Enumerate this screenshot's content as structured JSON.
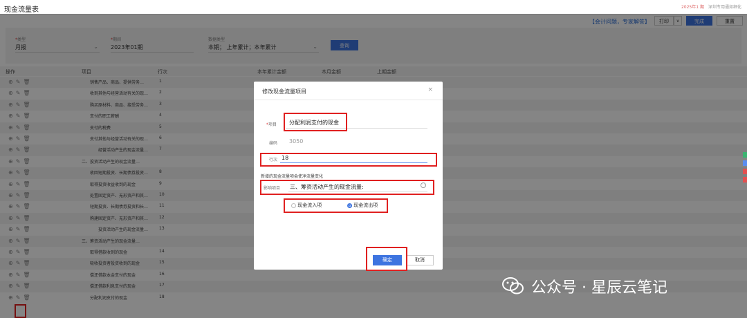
{
  "header": {
    "title": "现金流量表",
    "info_1": "2025年1 期",
    "info_2": "深圳专用通如细化"
  },
  "toolbar": {
    "help_link": "【会计问题，专家解答】",
    "print_label": "打印",
    "print_arrow": "∨",
    "done_label": "完成",
    "reset_label": "重置"
  },
  "filters": {
    "type_label": "类型",
    "type_value": "月报",
    "period_label": "期间",
    "period_value": "2023年01期",
    "data_type_label": "数据类型",
    "data_type_value": "本期；  上年累计；本年累计",
    "query_label": "查询",
    "required_mark": "*"
  },
  "table": {
    "headers": [
      "操作",
      "项目",
      "行次",
      "本年累计金额",
      "本月金额",
      "上期金额"
    ],
    "rows": [
      {
        "item": "销售产品、商品、提供劳务…",
        "num": "1",
        "indent": 1
      },
      {
        "item": "收到其他与经营活动有关的现…",
        "num": "2",
        "indent": 1
      },
      {
        "item": "购买原材料、商品、接受劳务…",
        "num": "3",
        "indent": 1
      },
      {
        "item": "支付的职工薪酬",
        "num": "4",
        "indent": 1
      },
      {
        "item": "支付的税费",
        "num": "5",
        "indent": 1
      },
      {
        "item": "支付其他与经营活动有关的现…",
        "num": "6",
        "indent": 1
      },
      {
        "item": "经营活动产生的现金流量…",
        "num": "7",
        "indent": 2
      },
      {
        "item": "二、投资活动产生的现金流量…",
        "num": "",
        "indent": 0
      },
      {
        "item": "收回短期投资、长期债券投资…",
        "num": "8",
        "indent": 1
      },
      {
        "item": "取得投资收益收到的现金",
        "num": "9",
        "indent": 1
      },
      {
        "item": "处置固定资产、无形资产和其…",
        "num": "10",
        "indent": 1
      },
      {
        "item": "短期投资、长期债券投资和长…",
        "num": "11",
        "indent": 1
      },
      {
        "item": "购建固定资产、无形资产和其…",
        "num": "12",
        "indent": 1
      },
      {
        "item": "投资活动产生的现金流量…",
        "num": "13",
        "indent": 2
      },
      {
        "item": "三、筹资活动产生的现金流量…",
        "num": "",
        "indent": 0
      },
      {
        "item": "取得借款收到的现金",
        "num": "14",
        "indent": 1
      },
      {
        "item": "吸收投资者投资收到的现金",
        "num": "15",
        "indent": 1
      },
      {
        "item": "偿还借款本金支付的现金",
        "num": "16",
        "indent": 1
      },
      {
        "item": "偿还借款利息支付的现金",
        "num": "17",
        "indent": 1
      },
      {
        "item": "分配利润支付的现金",
        "num": "18",
        "indent": 1
      }
    ]
  },
  "modal": {
    "title": "修改现金流量项目",
    "close": "×",
    "item_label": "项目",
    "item_value": "分配利润支付的现金",
    "code_label": "编码",
    "code_value": "3050",
    "row_label": "行次",
    "row_value": "18",
    "note": "新增的现金流量项会使净流量变化",
    "impact_label": "影响项目",
    "impact_value": "三、筹资活动产生的现金流量:",
    "radio_in": "现金流入项",
    "radio_out": "现金流出项",
    "radio_selected": "现金流出项",
    "confirm_label": "确定",
    "cancel_label": "取消",
    "required_mark": "*"
  },
  "watermark": {
    "text": "公众号 · 星辰云笔记"
  },
  "colors": {
    "primary": "#3d74e0",
    "highlight": "#e02020",
    "overlay": "rgba(0,0,0,0.48)"
  }
}
